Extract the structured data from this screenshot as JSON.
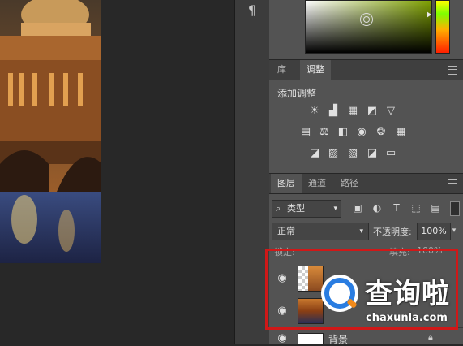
{
  "panels": {
    "paragraph_button": "¶",
    "library_tab": "库",
    "adjustments_tab": "调整",
    "add_adjustment": "添加调整"
  },
  "adjustment_icons_row1": [
    "brightness-icon",
    "levels-icon",
    "curves-icon",
    "exposure-icon",
    "vibrance-icon"
  ],
  "adjustment_icons_row2": [
    "hue-saturation-icon",
    "color-balance-icon",
    "black-white-icon",
    "photo-filter-icon",
    "channel-mixer-icon",
    "color-lookup-icon"
  ],
  "adjustment_icons_row3": [
    "invert-icon",
    "posterize-icon",
    "threshold-icon",
    "selective-color-icon",
    "gradient-map-icon"
  ],
  "layers_panel": {
    "tabs": [
      "图层",
      "通道",
      "路径"
    ],
    "active_tab": "图层",
    "filter_kind": "类型",
    "blend_mode": "正常",
    "opacity_label": "不透明度:",
    "opacity_value": "100%",
    "lock_label": "锁定:",
    "fill_label": "填充:",
    "fill_value": "100%",
    "background_layer_name": "背景"
  },
  "watermark": {
    "brand": "查询啦",
    "url": "chaxunla.com"
  },
  "colors": {
    "highlight": "#d01818",
    "panel_bg": "#535353",
    "watermark_blue": "#2a7de1",
    "watermark_orange": "#f28a1a"
  }
}
